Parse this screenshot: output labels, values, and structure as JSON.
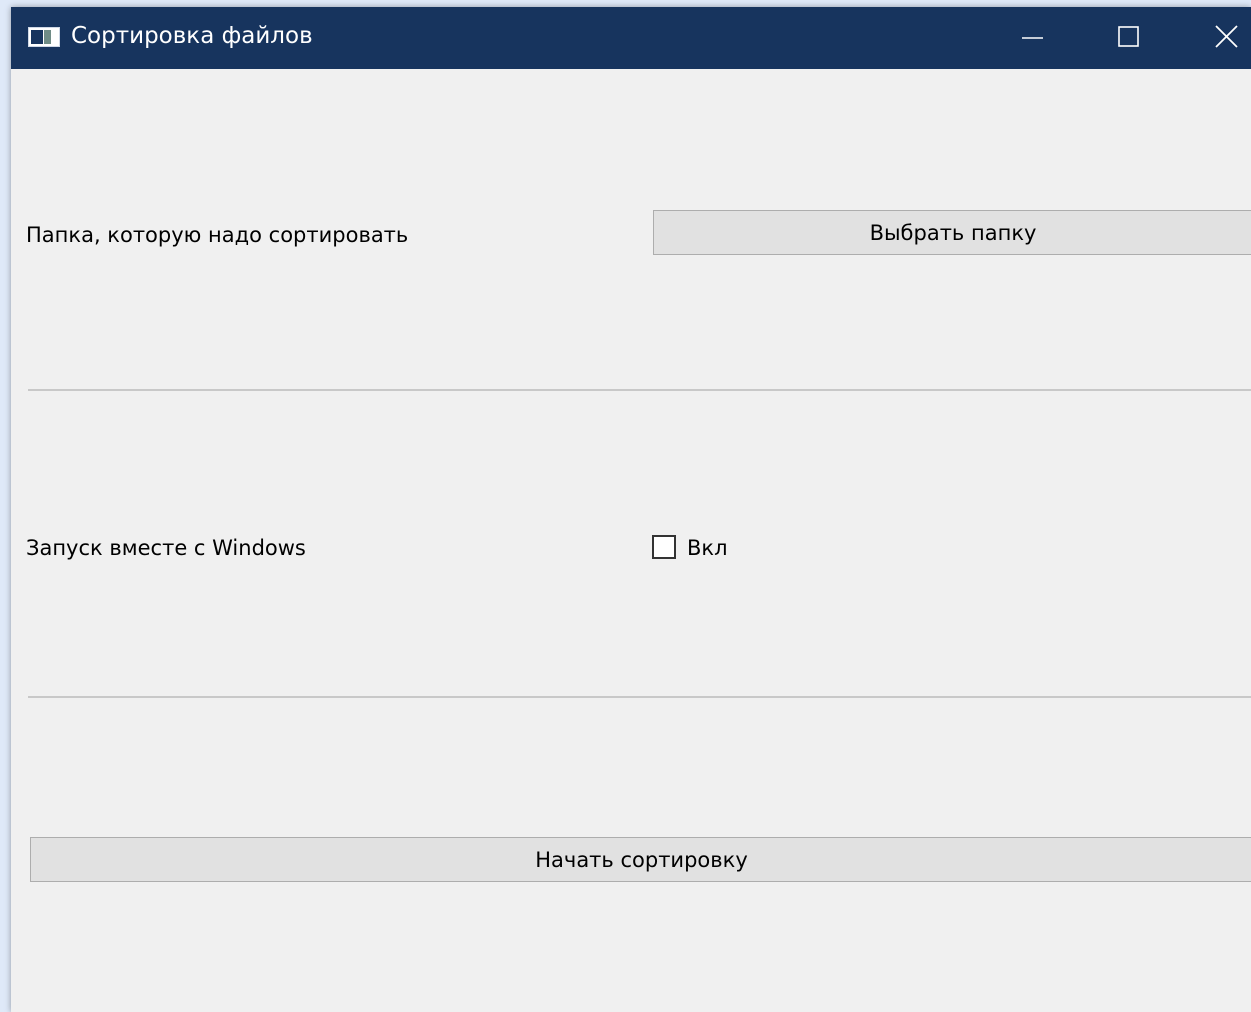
{
  "window": {
    "title": "Сортировка файлов",
    "controls": {
      "minimize": "minimize-icon",
      "maximize": "maximize-icon",
      "close": "close-icon"
    },
    "colors": {
      "titlebar": "#17345e",
      "background": "#f0f0f0",
      "button": "#e1e1e1"
    }
  },
  "folder_row": {
    "label": "Папка, которую надо сортировать",
    "button_label": "Выбрать папку"
  },
  "autostart_row": {
    "label": "Запуск вместе с Windows",
    "checkbox_label": "Вкл",
    "checked": false
  },
  "actions": {
    "start_label": "Начать сортировку"
  }
}
